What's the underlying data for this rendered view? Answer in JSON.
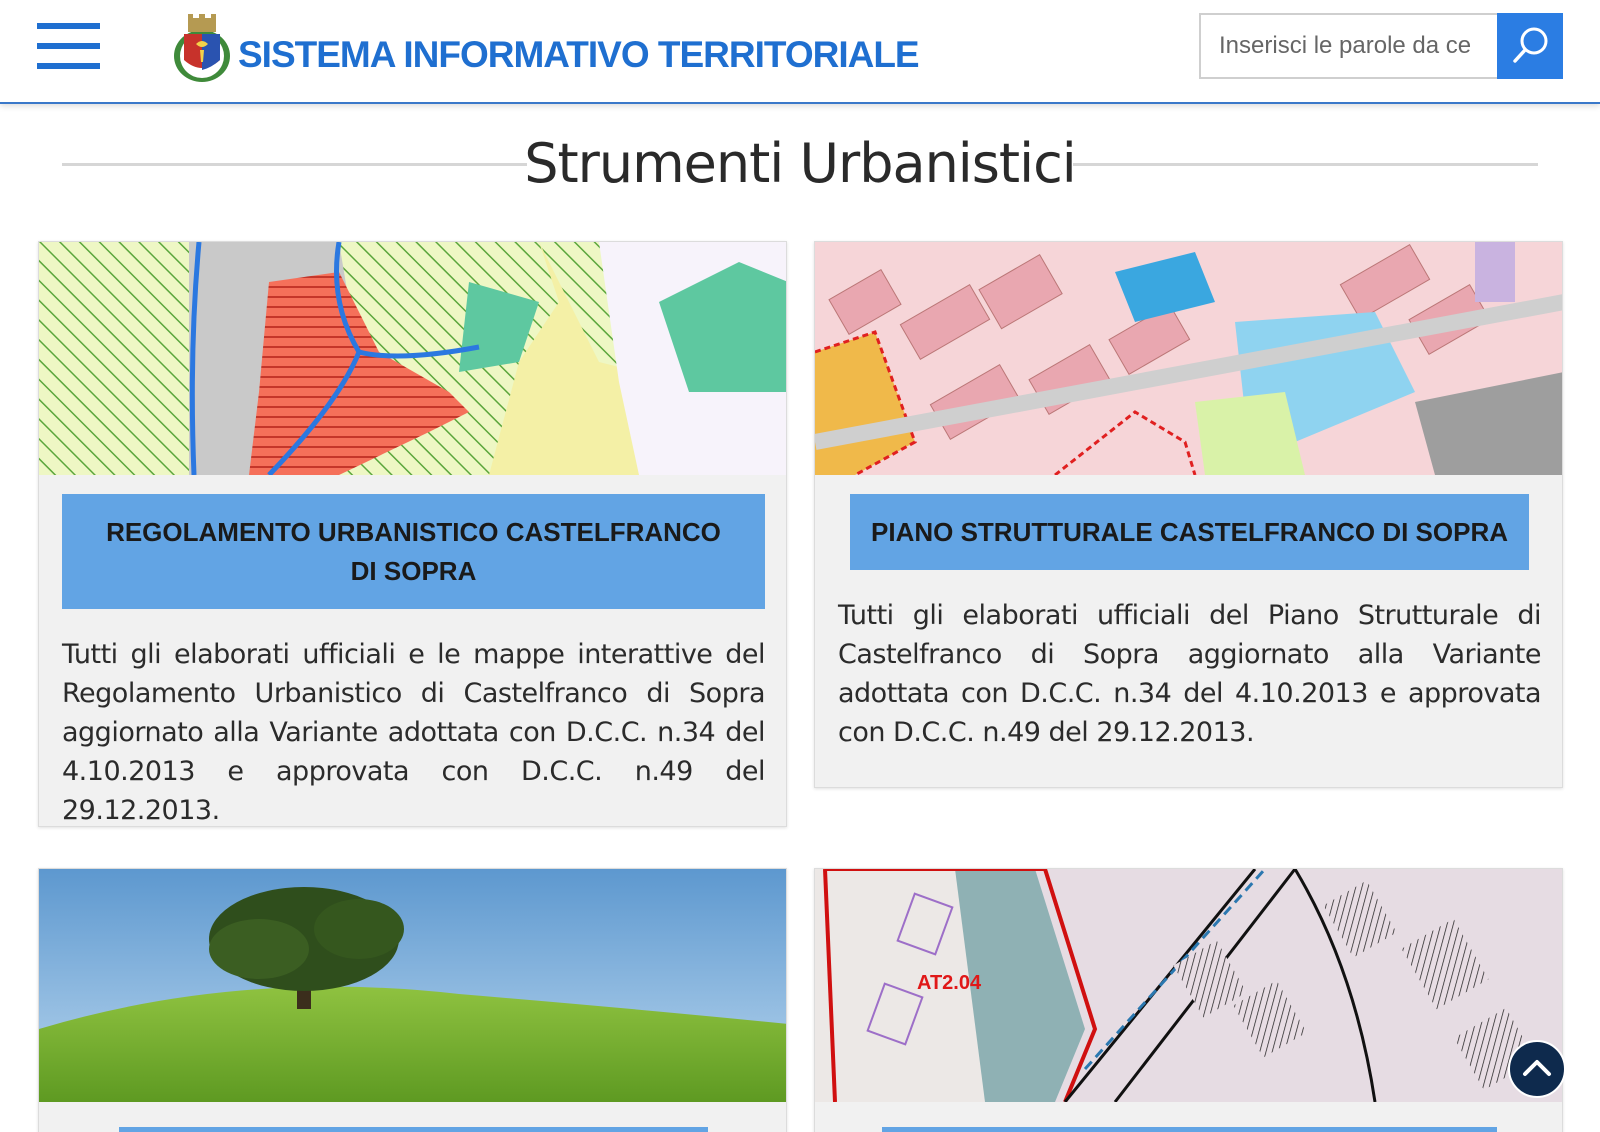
{
  "header": {
    "title": "SISTEMA INFORMATIVO TERRITORIALE",
    "search_placeholder": "Inserisci le parole da ce",
    "menu_icon": "hamburger-menu-icon",
    "search_icon": "search-icon",
    "brand_color": "#1f6fd0"
  },
  "section": {
    "title": "Strumenti Urbanistici"
  },
  "cards": [
    {
      "button_label": "REGOLAMENTO URBANISTICO CASTELFRANCO DI SOPRA",
      "description": "Tutti gli elaborati ufficiali e le mappe interattive del Regolamento Urbanistico di Castelfranco di Sopra aggiornato alla Variante adottata con D.C.C. n.34 del 4.10.2013 e approvata con D.C.C. n.49 del 29.12.2013."
    },
    {
      "button_label": "PIANO STRUTTURALE CASTELFRANCO DI SOPRA",
      "description": "Tutti gli elaborati ufficiali del Piano Strutturale di Castelfranco di Sopra aggiornato alla Variante adottata con D.C.C. n.34 del 4.10.2013 e approvata con D.C.C. n.49 del 29.12.2013."
    },
    {
      "image": "landscape-tree"
    },
    {
      "image": "cadastral-map",
      "map_label": "AT2.04"
    }
  ],
  "scroll_top_icon": "chevron-up-icon",
  "accent_color": "#62a4e4"
}
